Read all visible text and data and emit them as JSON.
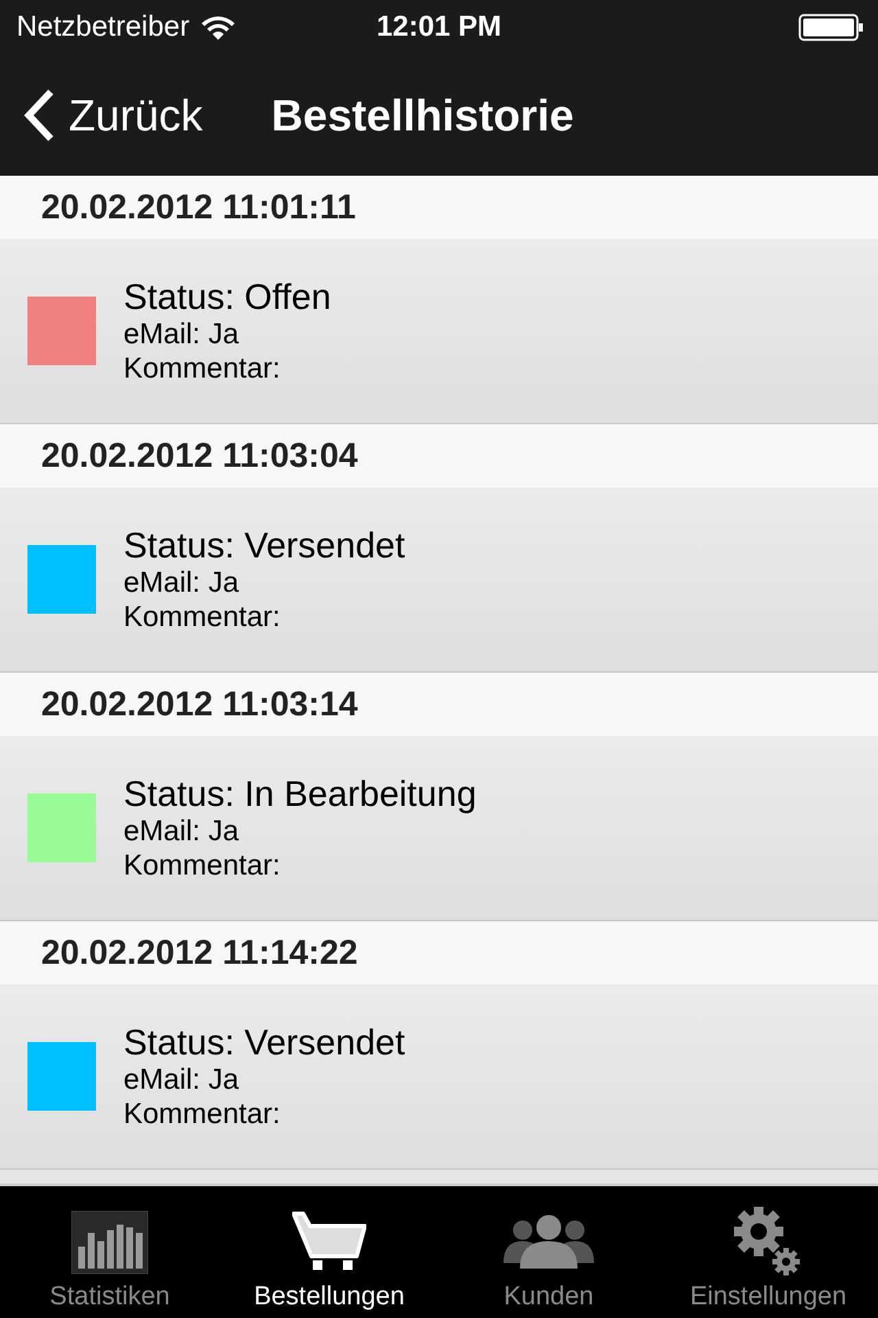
{
  "status_bar": {
    "carrier": "Netzbetreiber",
    "time": "12:01 PM"
  },
  "nav": {
    "back": "Zurück",
    "title": "Bestellhistorie"
  },
  "orders": [
    {
      "date": "20.02.2012 11:01:11",
      "status": "Status: Offen",
      "email": "eMail: Ja",
      "comment": "Kommentar:",
      "color": "#f08080"
    },
    {
      "date": "20.02.2012 11:03:04",
      "status": "Status: Versendet",
      "email": "eMail: Ja",
      "comment": "Kommentar:",
      "color": "#00bfff"
    },
    {
      "date": "20.02.2012 11:03:14",
      "status": "Status: In Bearbeitung",
      "email": "eMail: Ja",
      "comment": "Kommentar:",
      "color": "#98fb98"
    },
    {
      "date": "20.02.2012 11:14:22",
      "status": "Status: Versendet",
      "email": "eMail: Ja",
      "comment": "Kommentar:",
      "color": "#00bfff"
    }
  ],
  "tabs": [
    {
      "kind": "chart",
      "label": "Statistiken",
      "selected": false
    },
    {
      "kind": "cart",
      "label": "Bestellungen",
      "selected": true
    },
    {
      "kind": "people",
      "label": "Kunden",
      "selected": false
    },
    {
      "kind": "gears",
      "label": "Einstellungen",
      "selected": false
    }
  ]
}
